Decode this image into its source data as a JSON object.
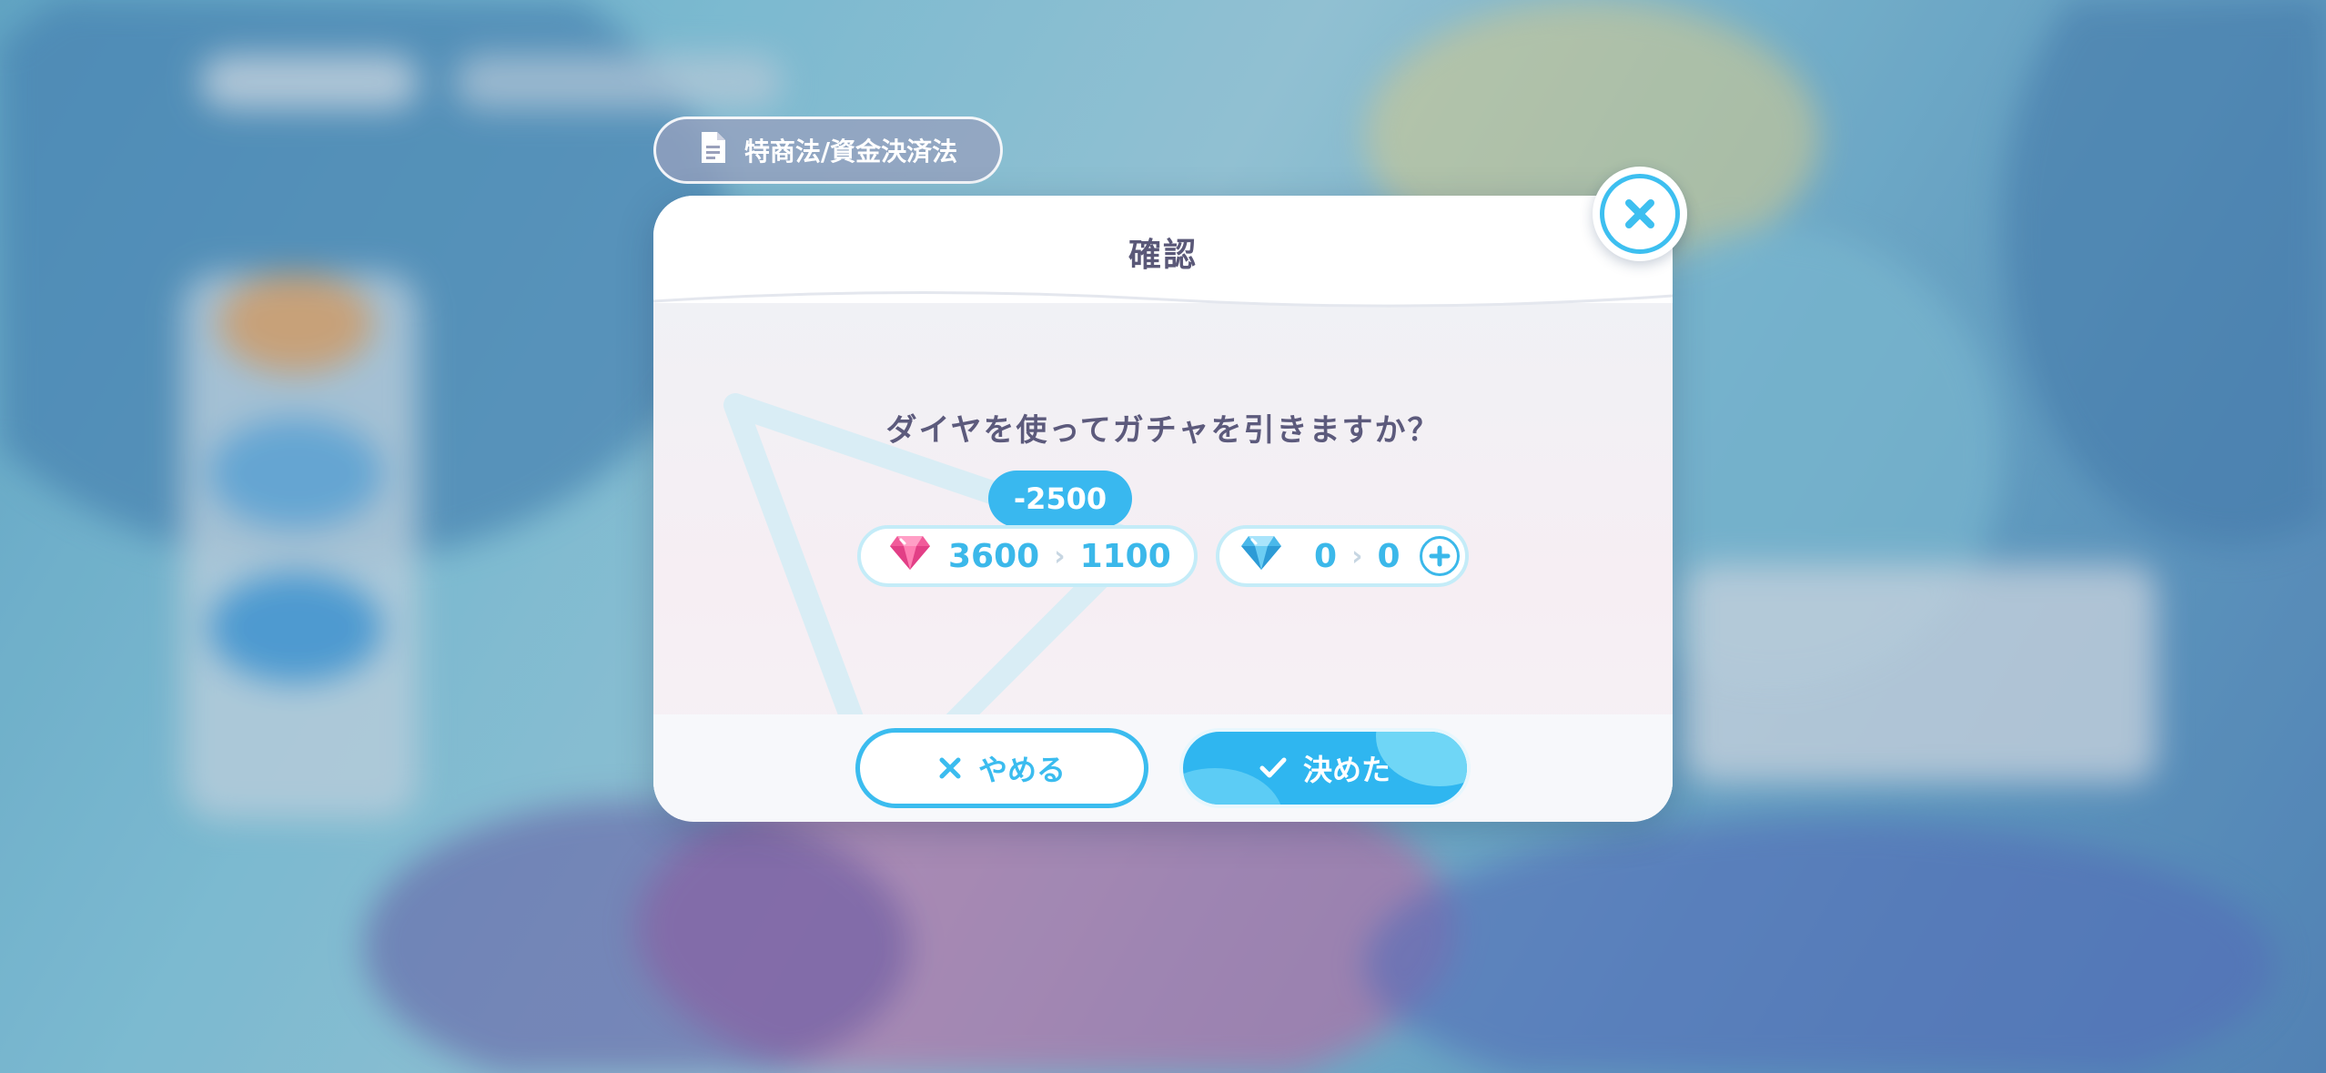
{
  "law_tab": {
    "label": "特商法/資金決済法",
    "icon": "document-icon"
  },
  "dialog": {
    "title": "確認",
    "question": "ダイヤを使ってガチャを引きますか？",
    "cost_badge": "-2500",
    "paid_gems": {
      "icon": "pink-gem-icon",
      "before": "3600",
      "after": "1100"
    },
    "free_gems": {
      "icon": "blue-gem-icon",
      "before": "0",
      "after": "0",
      "add_icon": "plus-icon"
    },
    "cancel_label": "やめる",
    "confirm_label": "決めた",
    "close_icon": "close-icon"
  },
  "colors": {
    "accent": "#39b8ef",
    "title_text": "#5a5878",
    "muted_chevron": "#c7d6e2"
  }
}
